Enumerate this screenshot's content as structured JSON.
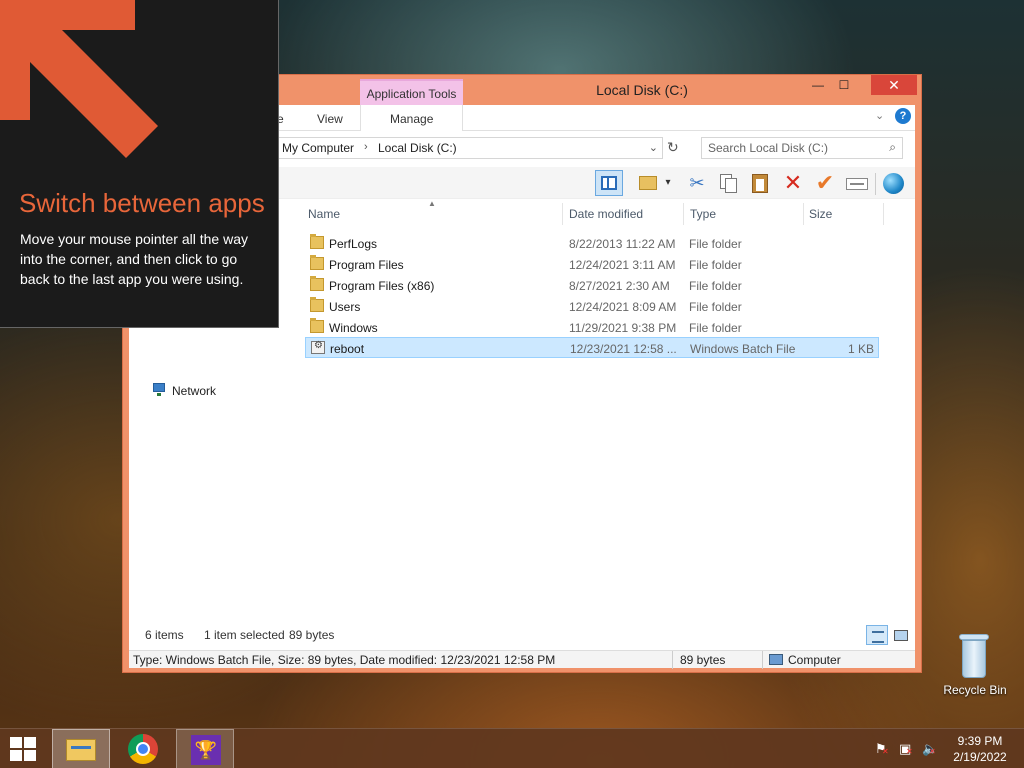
{
  "window": {
    "title": "Local Disk (C:)",
    "context_tab": "Application Tools",
    "controls": {
      "minimize": "—",
      "maximize": "☐",
      "close": "✕"
    }
  },
  "ribbon": {
    "tabs": [
      "e",
      "View",
      "Manage"
    ],
    "help": "?"
  },
  "address": {
    "crumbs": [
      "My Computer",
      "Local Disk (C:)"
    ],
    "separator": "›",
    "dropdown": "⌄",
    "refresh": "↻"
  },
  "search": {
    "placeholder": "Search Local Disk (C:)",
    "icon": "⌕"
  },
  "toolbar": {
    "icons": [
      "layout-pane-icon",
      "folder-options-icon",
      "cut-icon",
      "copy-icon",
      "paste-icon",
      "delete-icon",
      "checkmark-icon",
      "rename-icon",
      "globe-icon"
    ],
    "cut_glyph": "✂",
    "delete_glyph": "✕",
    "check_glyph": "✔",
    "dropdown_glyph": "▾"
  },
  "columns": {
    "name": "Name",
    "date": "Date modified",
    "type": "Type",
    "size": "Size",
    "sort_glyph": "▲"
  },
  "files": [
    {
      "name": "PerfLogs",
      "date": "8/22/2013 11:22 AM",
      "type": "File folder",
      "size": "",
      "kind": "folder"
    },
    {
      "name": "Program Files",
      "date": "12/24/2021 3:11 AM",
      "type": "File folder",
      "size": "",
      "kind": "folder"
    },
    {
      "name": "Program Files (x86)",
      "date": "8/27/2021 2:30 AM",
      "type": "File folder",
      "size": "",
      "kind": "folder"
    },
    {
      "name": "Users",
      "date": "12/24/2021 8:09 AM",
      "type": "File folder",
      "size": "",
      "kind": "folder"
    },
    {
      "name": "Windows",
      "date": "11/29/2021 9:38 PM",
      "type": "File folder",
      "size": "",
      "kind": "folder"
    },
    {
      "name": "reboot",
      "date": "12/23/2021 12:58 ...",
      "type": "Windows Batch File",
      "size": "1 KB",
      "kind": "batch",
      "selected": true
    }
  ],
  "nav": {
    "network": "Network"
  },
  "status": {
    "items": "6 items",
    "selected": "1 item selected",
    "bytes": "89 bytes"
  },
  "details_bar": {
    "description": "Type: Windows Batch File, Size: 89 bytes, Date modified: 12/23/2021 12:58 PM",
    "size": "89 bytes",
    "location": "Computer"
  },
  "hint": {
    "title": "Switch between apps",
    "body": "Move your mouse pointer all the way into the corner, and then click to go back to the last app you were using.",
    "accent": "#e8663a"
  },
  "desktop": {
    "recycle_bin": "Recycle Bin"
  },
  "taskbar": {
    "apps": [
      "file-explorer-icon",
      "chrome-icon",
      "trophy-app-icon"
    ],
    "trophy_glyph": "🏆",
    "tray": {
      "flag": "⚑",
      "network": "▣",
      "volume": "🔈",
      "error_mark": "✕"
    },
    "time": "9:39 PM",
    "date": "2/19/2022"
  }
}
